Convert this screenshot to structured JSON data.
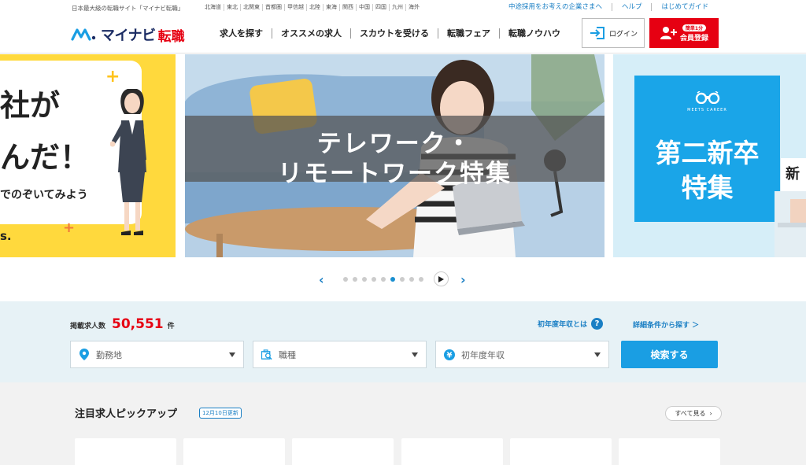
{
  "topbar": {
    "tagline": "日本最大級の転職サイト「マイナビ転職」",
    "regions": [
      "北海道",
      "東北",
      "北関東",
      "首都圏",
      "甲信越",
      "北陸",
      "東海",
      "関西",
      "中国",
      "四国",
      "九州",
      "海外"
    ],
    "links": [
      "中途採用をお考えの企業さまへ",
      "ヘルプ",
      "はじめてガイド"
    ]
  },
  "header": {
    "logo_text": "マイナビ",
    "logo_sub": "転職",
    "nav": [
      "求人を探す",
      "オススメの求人",
      "スカウトを受ける",
      "転職フェア",
      "転職ノウハウ"
    ],
    "login_label": "ログイン",
    "register_badge": "簡単1分",
    "register_label": "会員登録",
    "brand_color": "#e60012",
    "accent_color": "#1a9ee3"
  },
  "carousel": {
    "left": {
      "line1": "社が",
      "line2": "んだ！",
      "line3": "でのぞいてみよう",
      "line4": "s."
    },
    "main": {
      "line1": "テレワーク・",
      "line2": "リモートワーク特集"
    },
    "right": {
      "logo_name": "MEETS CAREER",
      "line1": "第二新卒",
      "line2": "特集",
      "peek": "新"
    },
    "pager": {
      "prev_icon": "chevron-left-icon",
      "next_icon": "chevron-right-icon",
      "dot_count": 9,
      "active_index": 5
    }
  },
  "search": {
    "count_label": "掲載求人数",
    "count_value": "50,551",
    "count_unit": "件",
    "salary_link": "初年度年収とは",
    "salary_help": "?",
    "detail_link": "詳細条件から探す ＞",
    "location_placeholder": "勤務地",
    "jobtype_placeholder": "職種",
    "salary_placeholder": "初年度年収",
    "salary_icon_glyph": "¥",
    "search_button": "検索する"
  },
  "pickup": {
    "title": "注目求人ピックアップ",
    "badge": "12月10日更新",
    "see_all": "すべて見る",
    "see_all_arrow": "›",
    "card_count": 6
  }
}
